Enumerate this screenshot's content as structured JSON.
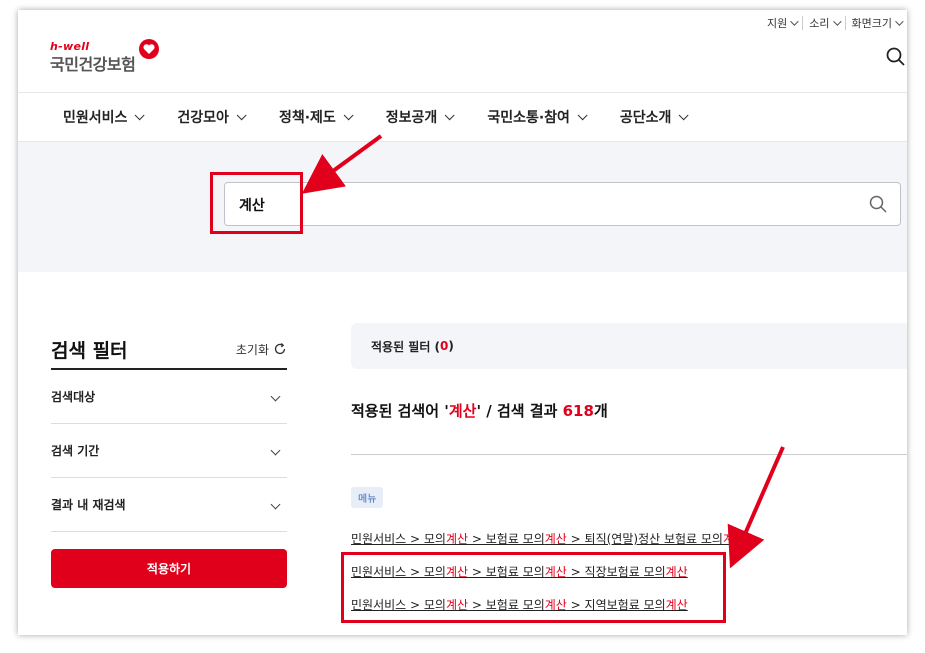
{
  "utility": [
    {
      "label": "지원"
    },
    {
      "label": "소리"
    },
    {
      "label": "화면크기"
    }
  ],
  "logo": {
    "sub": "h-well",
    "main": "국민건강보험"
  },
  "nav": [
    {
      "label": "민원서비스"
    },
    {
      "label": "건강모아"
    },
    {
      "label": "정책·제도"
    },
    {
      "label": "정보공개"
    },
    {
      "label": "국민소통·참여"
    },
    {
      "label": "공단소개"
    }
  ],
  "search": {
    "value": "계산"
  },
  "filter": {
    "title": "검색 필터",
    "reset_label": "초기화",
    "rows": [
      {
        "label": "검색대상"
      },
      {
        "label": "검색 기간"
      },
      {
        "label": "결과 내 재검색"
      }
    ],
    "apply_label": "적용하기"
  },
  "results": {
    "applied_label": "적용된 필터 (",
    "applied_count": "0",
    "applied_close": ")",
    "summary_prefix": "적용된 검색어 '",
    "keyword": "계산",
    "summary_mid": "' / 검색 결과 ",
    "count": "618",
    "summary_suffix": "개",
    "category_badge": "메뉴",
    "links": [
      {
        "p1": "민원서비스 > 모의",
        "h1": "계산",
        "p2": " > 보험료 모의",
        "h2": "계산",
        "p3": " > 퇴직(연말)정산 보험료 모의",
        "h3": "계산"
      },
      {
        "p1": "민원서비스 > 모의",
        "h1": "계산",
        "p2": " > 보험료 모의",
        "h2": "계산",
        "p3": " > 직장보험료 모의",
        "h3": "계산"
      },
      {
        "p1": "민원서비스 > 모의",
        "h1": "계산",
        "p2": " > 보험료 모의",
        "h2": "계산",
        "p3": " > 지역보험료 모의",
        "h3": "계산"
      }
    ]
  },
  "colors": {
    "accent": "#e1001b",
    "band_bg": "#f4f5f8",
    "badge_text": "#3a67b5"
  },
  "icons": [
    "chevron-down-icon",
    "search-icon",
    "refresh-icon",
    "heart-logo-icon"
  ]
}
